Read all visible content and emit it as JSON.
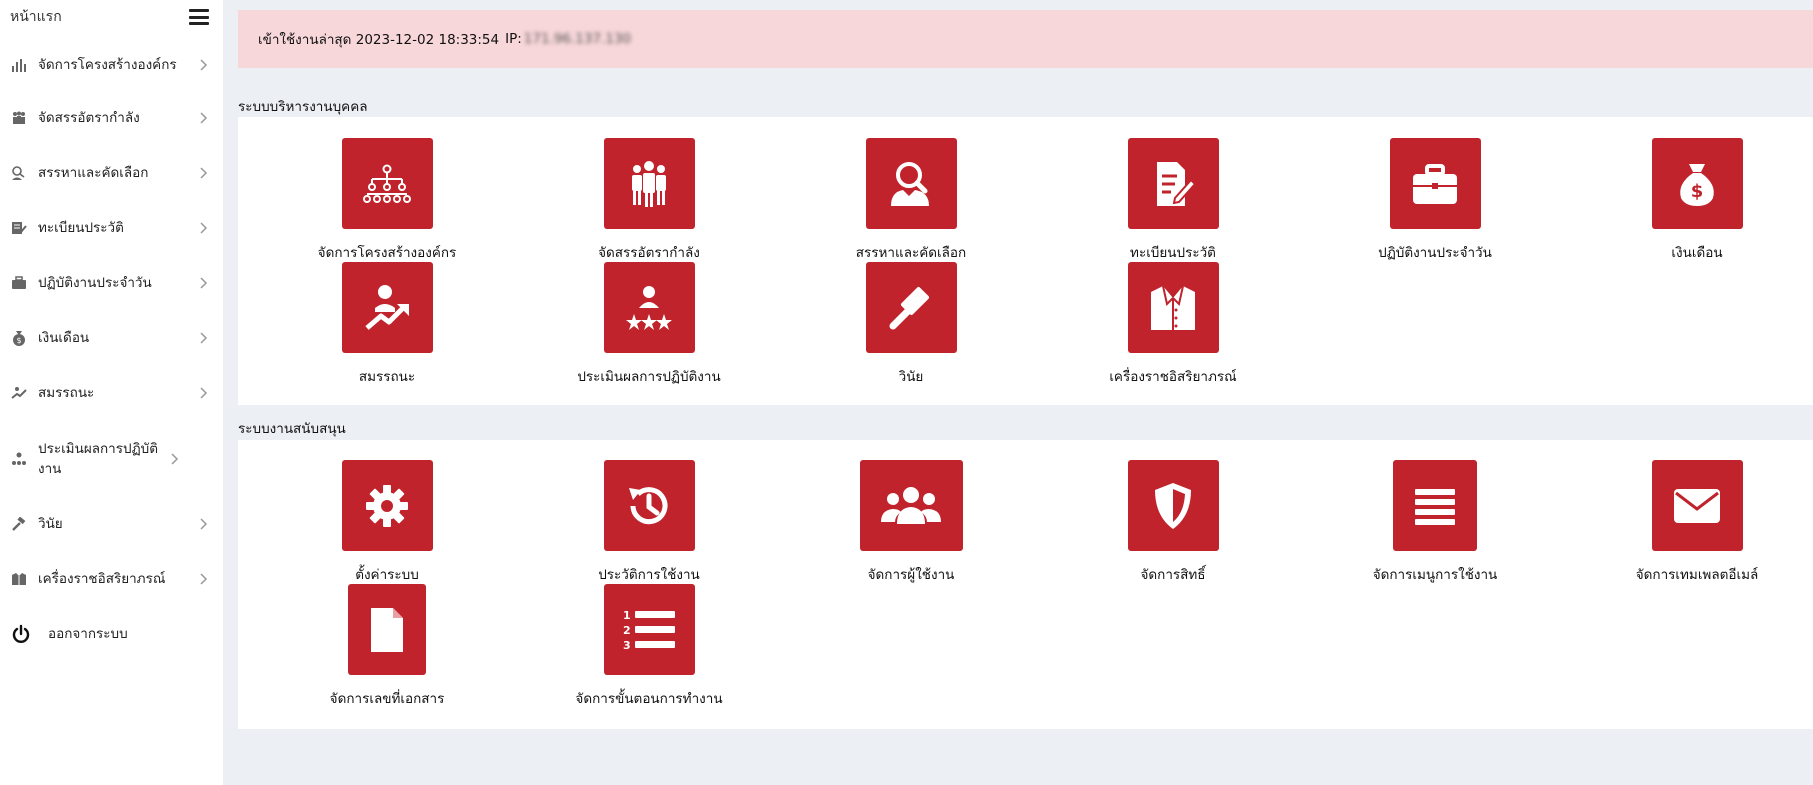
{
  "sidebar": {
    "home_label": "หน้าแรก",
    "items": [
      {
        "label": "จัดการโครงสร้างองค์กร",
        "icon": "chart-bars-icon"
      },
      {
        "label": "จัดสรรอัตรากำลัง",
        "icon": "people-group-icon"
      },
      {
        "label": "สรรหาและคัดเลือก",
        "icon": "user-search-icon"
      },
      {
        "label": "ทะเบียนประวัติ",
        "icon": "document-edit-icon"
      },
      {
        "label": "ปฏิบัติงานประจำวัน",
        "icon": "briefcase-icon"
      },
      {
        "label": "เงินเดือน",
        "icon": "money-bag-icon"
      },
      {
        "label": "สมรรถนะ",
        "icon": "growth-icon"
      },
      {
        "label": "ประเมินผลการปฏิบัติงาน",
        "icon": "rating-icon"
      },
      {
        "label": "วินัย",
        "icon": "gavel-icon"
      },
      {
        "label": "เครื่องราชอิสริยาภรณ์",
        "icon": "uniform-icon"
      }
    ],
    "logout_label": "ออกจากระบบ"
  },
  "alert": {
    "text": "เข้าใช้งานล่าสุด 2023-12-02 18:33:54",
    "ip_label": "IP:",
    "ip_value": "171.96.137.130"
  },
  "sections": {
    "hr": {
      "title": "ระบบบริหารงานบุคคล",
      "tiles": [
        {
          "label": "จัดการโครงสร้างองค์กร",
          "icon": "org-chart-icon"
        },
        {
          "label": "จัดสรรอัตรากำลัง",
          "icon": "people-group-icon"
        },
        {
          "label": "สรรหาและคัดเลือก",
          "icon": "user-search-icon"
        },
        {
          "label": "ทะเบียนประวัติ",
          "icon": "document-edit-icon"
        },
        {
          "label": "ปฏิบัติงานประจำวัน",
          "icon": "briefcase-icon"
        },
        {
          "label": "เงินเดือน",
          "icon": "money-bag-icon"
        },
        {
          "label": "สมรรถนะ",
          "icon": "growth-icon"
        },
        {
          "label": "ประเมินผลการปฏิบัติงาน",
          "icon": "rating-icon"
        },
        {
          "label": "วินัย",
          "icon": "gavel-icon"
        },
        {
          "label": "เครื่องราชอิสริยาภรณ์",
          "icon": "uniform-icon"
        }
      ]
    },
    "support": {
      "title": "ระบบงานสนับสนุน",
      "tiles": [
        {
          "label": "ตั้งค่าระบบ",
          "icon": "gear-icon"
        },
        {
          "label": "ประวัติการใช้งาน",
          "icon": "history-icon"
        },
        {
          "label": "จัดการผู้ใช้งาน",
          "icon": "users-icon"
        },
        {
          "label": "จัดการสิทธิ์",
          "icon": "shield-icon"
        },
        {
          "label": "จัดการเมนูการใช้งาน",
          "icon": "menu-lines-icon"
        },
        {
          "label": "จัดการเทมเพลตอีเมล์",
          "icon": "envelope-icon"
        },
        {
          "label": "จัดการเลขที่เอกสาร",
          "icon": "file-icon"
        },
        {
          "label": "จัดการขั้นตอนการทำงาน",
          "icon": "numbered-list-icon"
        }
      ]
    }
  },
  "colors": {
    "tile_red": "#c0232b",
    "alert_bg": "#f8d7da",
    "page_bg": "#eceff3"
  }
}
